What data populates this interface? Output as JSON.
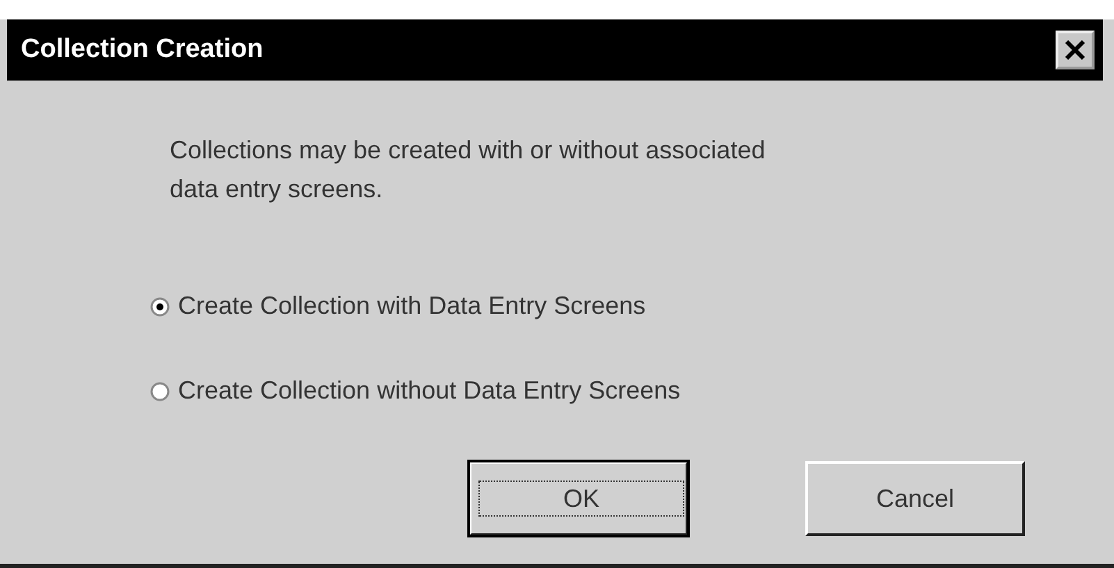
{
  "window": {
    "title": "Collection Creation"
  },
  "message": "Collections may be created with or without associated data entry screens.",
  "options": [
    {
      "label": "Create Collection with Data Entry Screens",
      "selected": true
    },
    {
      "label": "Create Collection without Data Entry Screens",
      "selected": false
    }
  ],
  "buttons": [
    {
      "label": "OK",
      "default": true
    },
    {
      "label": "Cancel",
      "default": false
    }
  ]
}
